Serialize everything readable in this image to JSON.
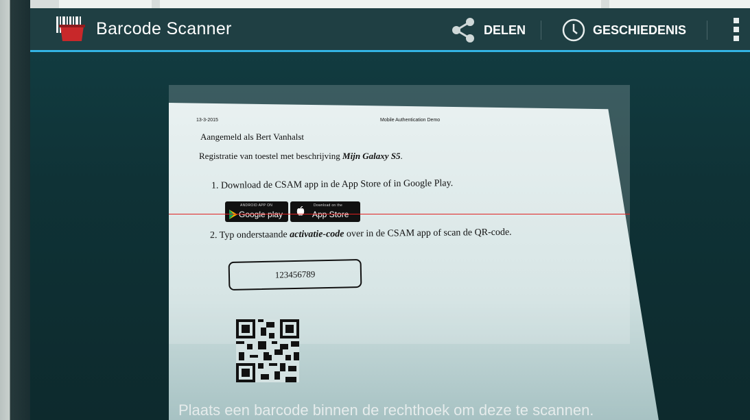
{
  "app": {
    "title": "Barcode Scanner",
    "icon": "barcode-scanner-app-icon"
  },
  "actions": {
    "share_label": "DELEN",
    "share_icon": "share-icon",
    "history_label": "GESCHIEDENIS",
    "history_icon": "clock-icon",
    "overflow_icon": "overflow-menu-icon"
  },
  "document": {
    "date": "13-3-2015",
    "header": "Mobile Authentication Demo",
    "logged_in": "Aangemeld als Bert Vanhalst",
    "registration_prefix": "Registratie van toestel met beschrijving ",
    "registration_device": "Mijn Galaxy S5",
    "registration_suffix": ".",
    "step1": "1.  Download de CSAM app in de App Store of in Google Play.",
    "google_badge_small": "ANDROID APP ON",
    "google_badge_big": "Google play",
    "apple_badge_small": "Download on the",
    "apple_badge_big": "App Store",
    "step2_prefix": "2.  Typ onderstaande ",
    "step2_em": "activatie-code",
    "step2_suffix": " over in de CSAM app of scan de QR-code.",
    "activation_code": "123456789"
  },
  "status_text": "Plaats een barcode binnen de rechthoek om deze te scannen.",
  "colors": {
    "accent": "#33b5e5",
    "scanline": "#e02020",
    "actionbar": "#1f3f43"
  }
}
